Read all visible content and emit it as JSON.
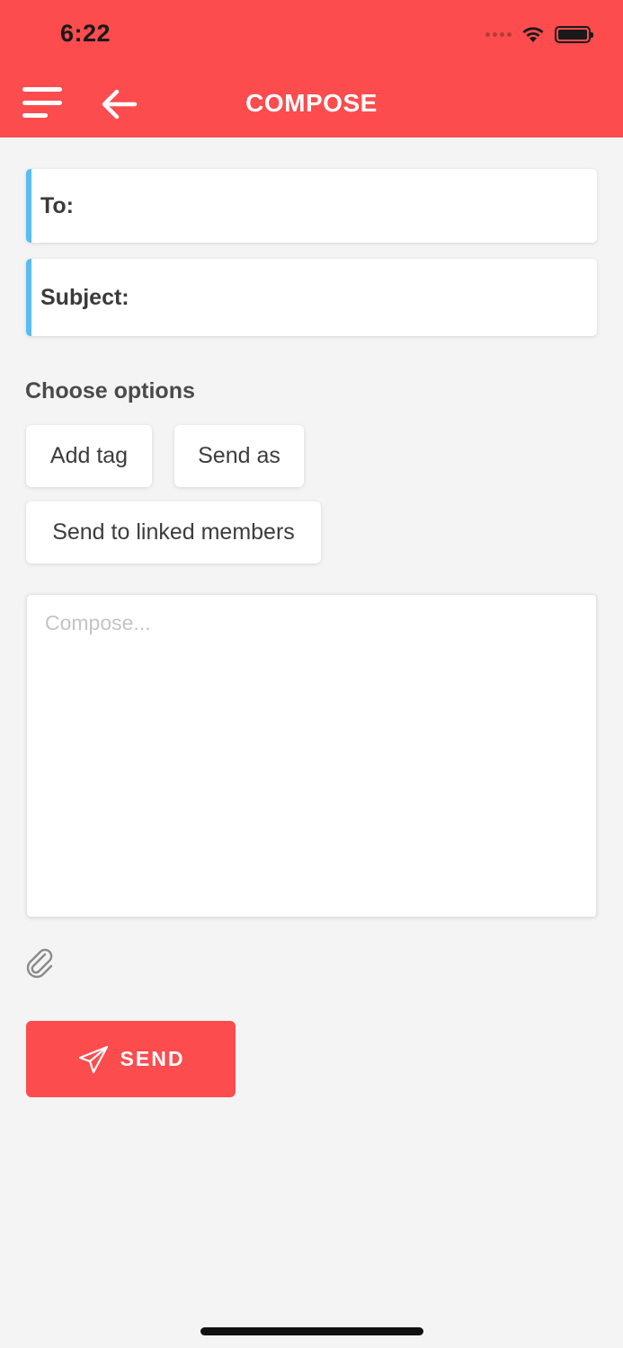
{
  "status_bar": {
    "time": "6:22"
  },
  "header": {
    "title": "COMPOSE",
    "background_color": "#fc4c4e",
    "menu_icon": "hamburger-menu-icon",
    "back_icon": "arrow-left-icon"
  },
  "form": {
    "to_label": "To:",
    "to_value": "",
    "subject_label": "Subject:",
    "subject_value": "",
    "accent_color": "#57bdf4"
  },
  "options": {
    "label": "Choose options",
    "chips": [
      "Add tag",
      "Send as",
      "Send to linked members"
    ]
  },
  "compose": {
    "placeholder": "Compose...",
    "value": ""
  },
  "attachment": {
    "icon": "paperclip-icon"
  },
  "send_button": {
    "label": "SEND",
    "icon": "paper-plane-icon",
    "color": "#fc4c4e"
  }
}
